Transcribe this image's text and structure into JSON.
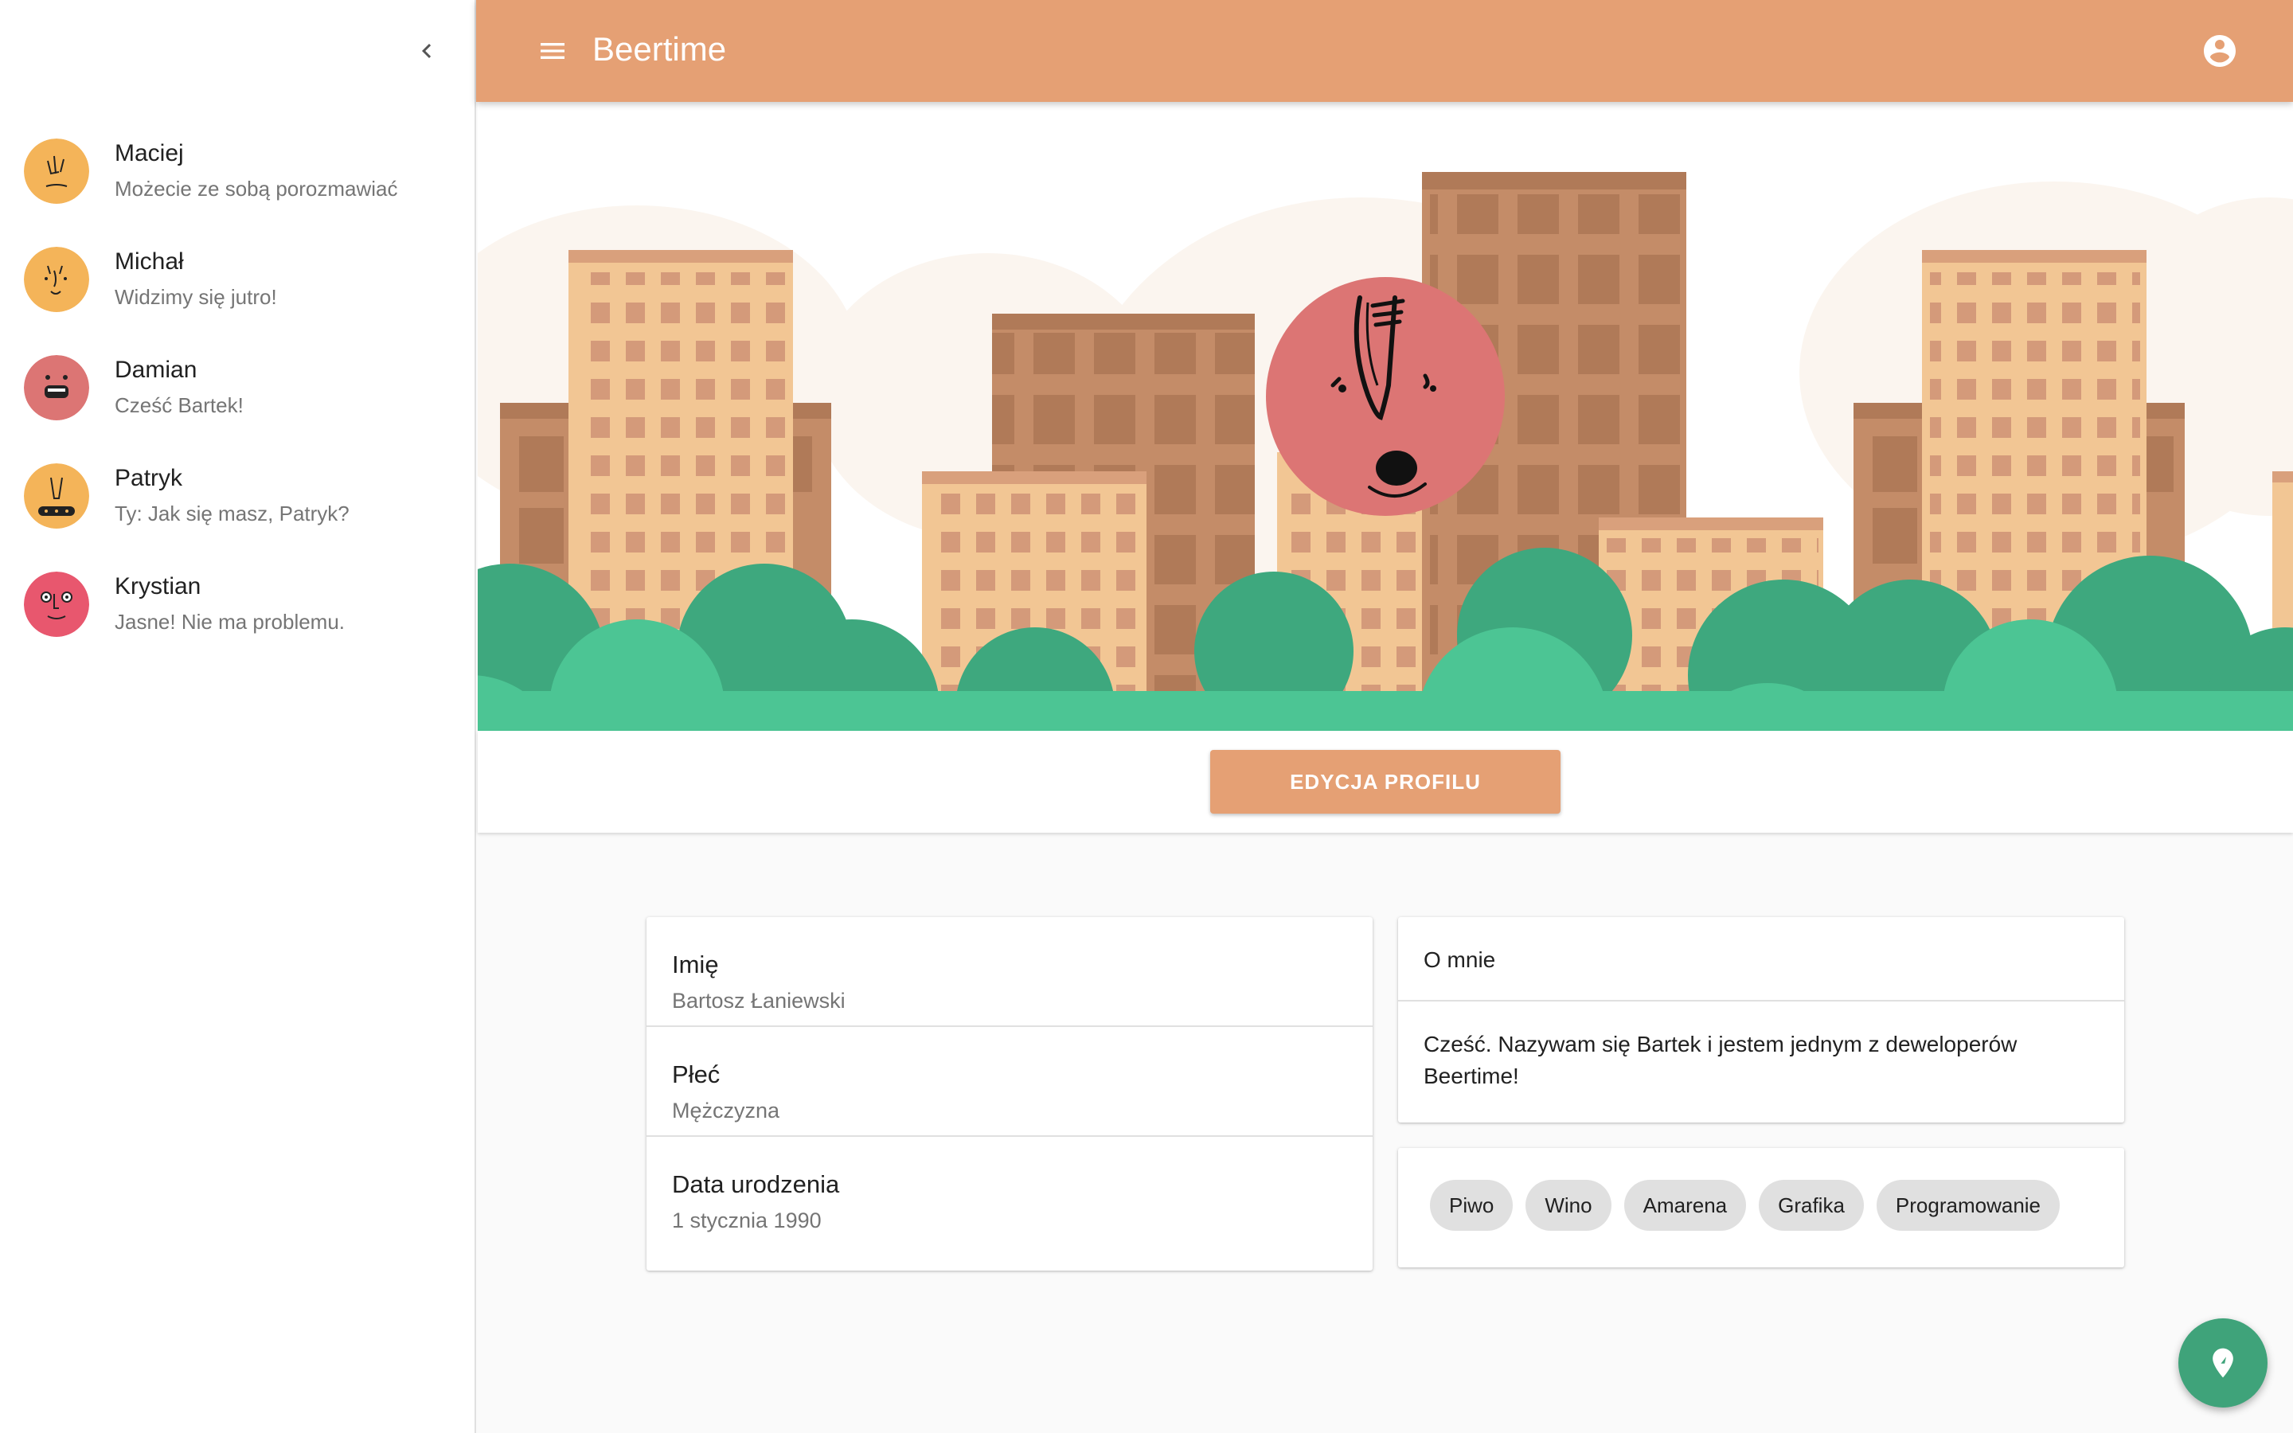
{
  "app": {
    "title": "Beertime"
  },
  "sidebar": {
    "contacts": [
      {
        "name": "Maciej",
        "message": "Możecie ze sobą porozmawiać",
        "avatar_color": "#f4b459"
      },
      {
        "name": "Michał",
        "message": "Widzimy się jutro!",
        "avatar_color": "#f4b459"
      },
      {
        "name": "Damian",
        "message": "Cześć Bartek!",
        "avatar_color": "#dc7574"
      },
      {
        "name": "Patryk",
        "message": "Ty: Jak się masz, Patryk?",
        "avatar_color": "#f4b459"
      },
      {
        "name": "Krystian",
        "message": "Jasne! Nie ma problemu.",
        "avatar_color": "#e8576e"
      }
    ]
  },
  "profile": {
    "edit_button": "EDYCJA PROFILU",
    "fields": [
      {
        "label": "Imię",
        "value": "Bartosz Łaniewski"
      },
      {
        "label": "Płeć",
        "value": "Mężczyzna"
      },
      {
        "label": "Data urodzenia",
        "value": "1 stycznia 1990"
      }
    ],
    "about": {
      "title": "O mnie",
      "text": "Cześć. Nazywam się Bartek i jestem jednym z deweloperów Beertime!"
    },
    "interests": [
      "Piwo",
      "Wino",
      "Amarena",
      "Grafika",
      "Programowanie"
    ]
  },
  "colors": {
    "primary": "#e5a074",
    "fab": "#3fa37a",
    "profile_avatar": "#dc7574",
    "grass": "#4cc594"
  },
  "icons": {
    "collapse": "chevron-left-icon",
    "menu": "menu-icon",
    "account": "account-circle-icon",
    "fab": "location-pin-icon"
  }
}
